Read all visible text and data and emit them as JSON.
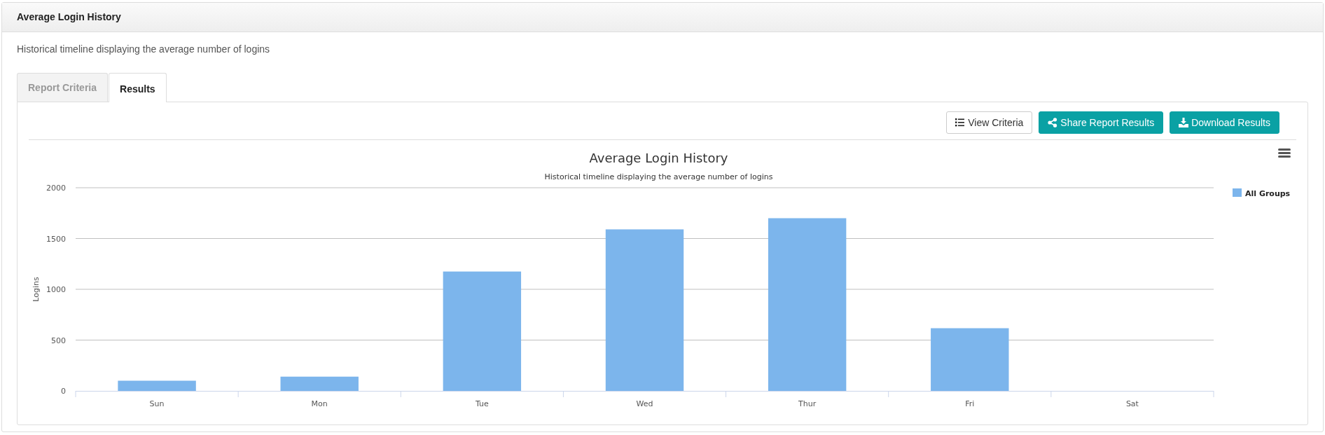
{
  "panel": {
    "title": "Average Login History",
    "description": "Historical timeline displaying the average number of logins"
  },
  "tabs": [
    {
      "label": "Report Criteria",
      "selected": false
    },
    {
      "label": "Results",
      "selected": true
    }
  ],
  "toolbar": [
    {
      "label": "View Criteria",
      "kind": "outline"
    },
    {
      "label": "Share Report Results",
      "kind": "primary"
    },
    {
      "label": "Download Results",
      "kind": "primary"
    }
  ],
  "chart": {
    "chart_data": {
      "type": "bar",
      "title": "Average Login History",
      "subtitle": "Historical timeline displaying the average number of logins",
      "ylabel": "Logins",
      "categories": [
        "Sun",
        "Mon",
        "Tue",
        "Wed",
        "Thur",
        "Fri",
        "Sat"
      ],
      "series": [
        {
          "name": "All Groups",
          "color": "#7cb5ec",
          "values": [
            100,
            140,
            1175,
            1590,
            1700,
            617,
            0
          ]
        }
      ],
      "grid": true,
      "ylim": [
        0,
        2000
      ],
      "yticks": [
        0,
        500,
        1000,
        1500,
        2000
      ]
    }
  }
}
